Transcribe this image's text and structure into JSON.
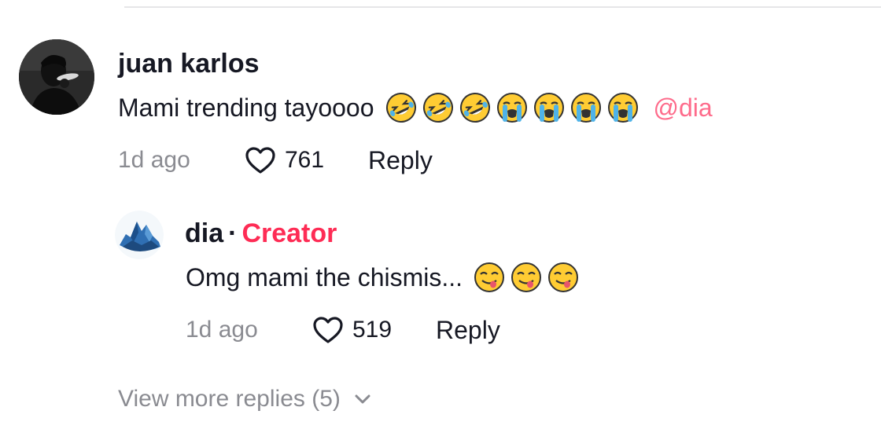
{
  "colors": {
    "text_primary": "#161823",
    "text_secondary": "#8a8b91",
    "accent_creator": "#fe2c55",
    "mention": "#fe6b8b"
  },
  "comment": {
    "username": "juan karlos",
    "text": "Mami trending tayoooo",
    "emojis": [
      "rolling-on-floor-laughing",
      "rolling-on-floor-laughing",
      "rolling-on-floor-laughing",
      "loudly-crying",
      "loudly-crying",
      "loudly-crying",
      "loudly-crying"
    ],
    "mention": "@dia",
    "timestamp": "1d ago",
    "likes": "761",
    "reply_label": "Reply"
  },
  "reply": {
    "username": "dia",
    "separator": "·",
    "badge": "Creator",
    "text": "Omg mami the chismis...",
    "emojis": [
      "face-savoring-food",
      "face-savoring-food",
      "face-savoring-food"
    ],
    "timestamp": "1d ago",
    "likes": "519",
    "reply_label": "Reply"
  },
  "view_more": {
    "label": "View more replies (5)",
    "icon": "chevron-down-icon"
  }
}
